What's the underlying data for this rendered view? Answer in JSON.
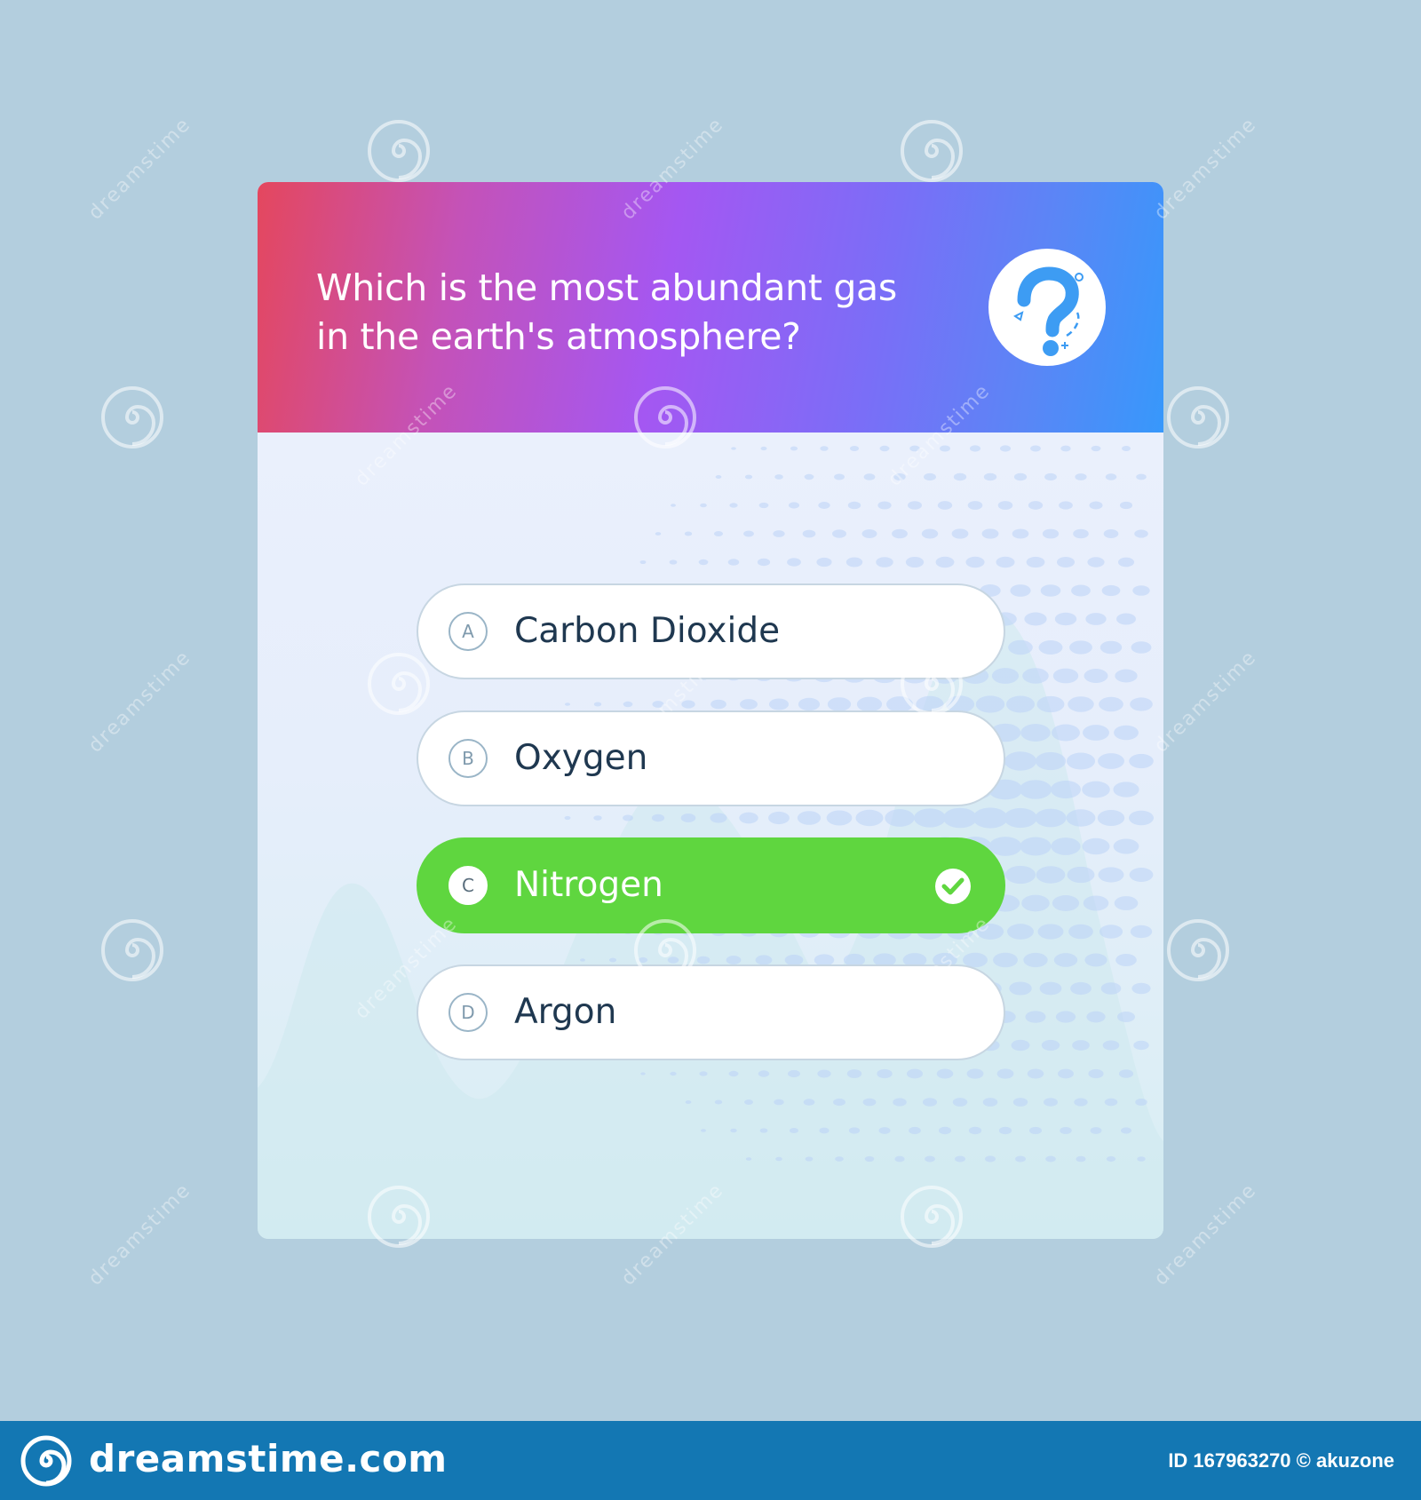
{
  "quiz": {
    "question": "Which is the most abundant gas\nin the earth's atmosphere?",
    "help_icon": "question-mark-icon",
    "options": [
      {
        "letter": "A",
        "label": "Carbon Dioxide",
        "correct": false
      },
      {
        "letter": "B",
        "label": "Oxygen",
        "correct": false
      },
      {
        "letter": "C",
        "label": "Nitrogen",
        "correct": true
      },
      {
        "letter": "D",
        "label": "Argon",
        "correct": false
      }
    ],
    "correct_indicator_icon": "check-circle-icon"
  },
  "watermark": {
    "text": "dreamstime",
    "icon": "swirl-logo-icon"
  },
  "footer": {
    "brand": "dreamstime.com",
    "id_text": "ID 167963270 © akuzone"
  },
  "colors": {
    "background": "#b3cede",
    "header_gradient_start": "#e4475e",
    "header_gradient_mid": "#a457f2",
    "header_gradient_end": "#3798fb",
    "correct_option": "#5fd63f",
    "option_text": "#1f3850",
    "help_icon": "#3d9cf3",
    "footer": "#1377b3"
  }
}
